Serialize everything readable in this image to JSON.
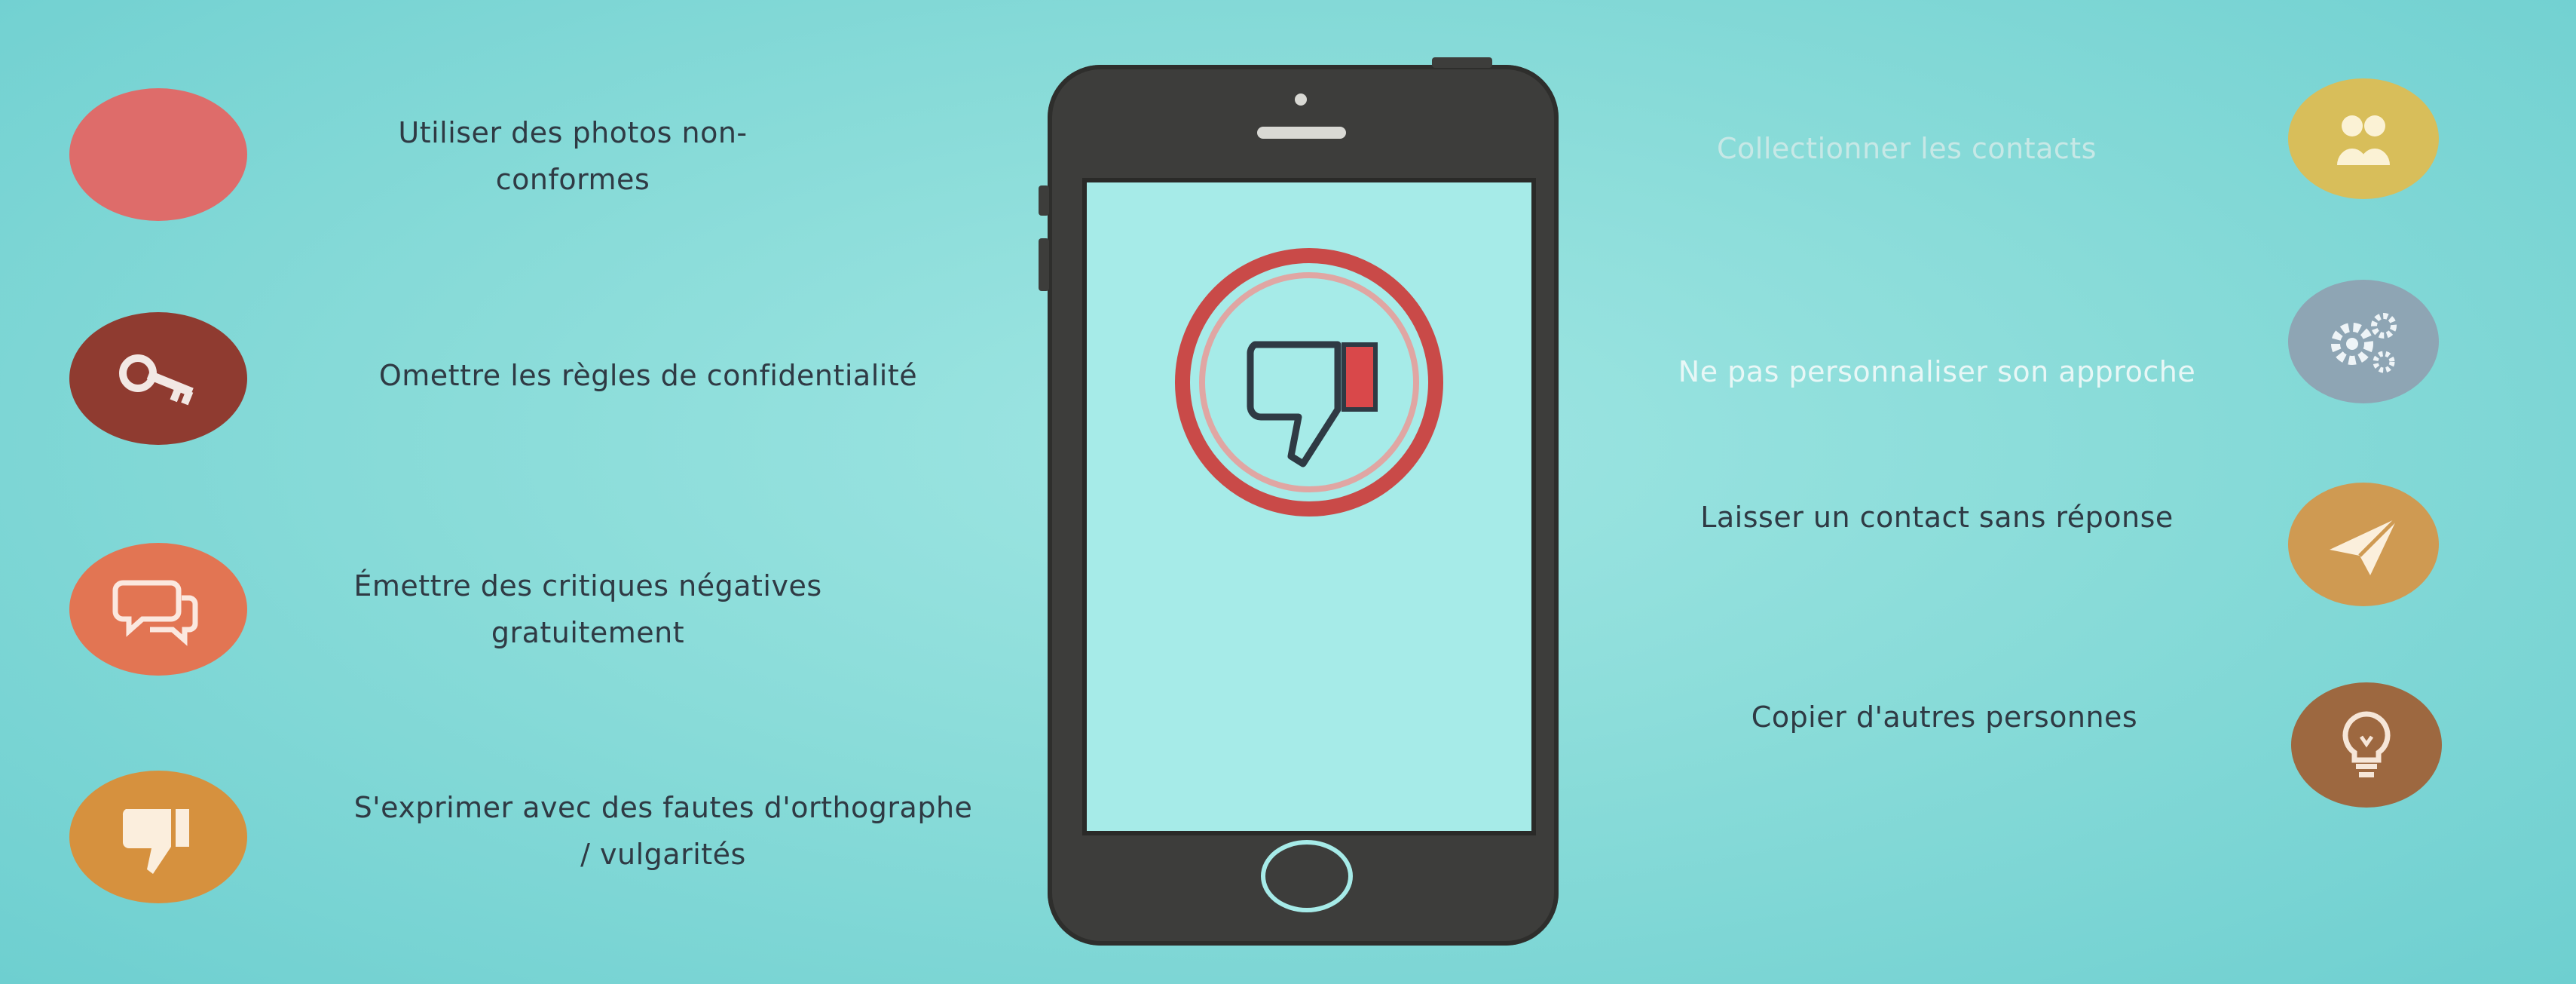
{
  "left_items": [
    {
      "lines": [
        "Utiliser des photos non-",
        "conformes"
      ],
      "icon": "blank-circle",
      "color": "#de6c6a"
    },
    {
      "lines": [
        "Omettre les règles de confidentialité"
      ],
      "icon": "key-icon",
      "color": "#8f3b30"
    },
    {
      "lines": [
        "Émettre des critiques négatives",
        "gratuitement"
      ],
      "icon": "chat-bubbles-icon",
      "color": "#e27553"
    },
    {
      "lines": [
        "S'exprimer avec des fautes d'orthographe",
        "/ vulgarités"
      ],
      "icon": "thumbs-down-icon",
      "color": "#d6913e"
    }
  ],
  "right_items": [
    {
      "lines": [
        "Collectionner les contacts"
      ],
      "icon": "people-icon",
      "color": "#d8be5a"
    },
    {
      "lines": [
        "Ne pas personnaliser son approche"
      ],
      "icon": "gears-icon",
      "color": "#8ea5b4"
    },
    {
      "lines": [
        "Laisser un contact sans réponse"
      ],
      "icon": "paper-plane-icon",
      "color": "#cf9a52"
    },
    {
      "lines": [
        "Copier d'autres personnes"
      ],
      "icon": "lightbulb-icon",
      "color": "#9d6840"
    }
  ],
  "center": {
    "icon": "dislike-thumbs-down-icon",
    "ring_color": "#c94a48",
    "fill_color": "#d9484a"
  }
}
